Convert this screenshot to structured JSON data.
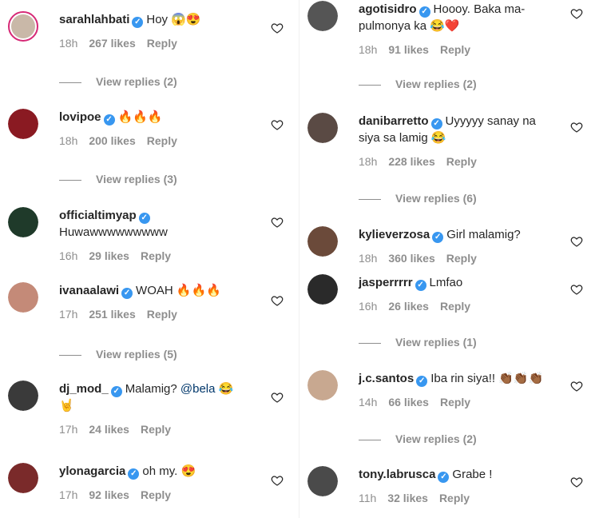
{
  "left": [
    {
      "user": "sarahlahbati",
      "text": "Hoy",
      "emoji": "😱😍",
      "time": "18h",
      "likes": "267 likes",
      "reply": "Reply",
      "view_replies": "View replies (2)",
      "avatar_color": "#c9b8a8",
      "ring": true
    },
    {
      "user": "lovipoe",
      "text": "",
      "emoji": "🔥🔥🔥",
      "time": "18h",
      "likes": "200 likes",
      "reply": "Reply",
      "view_replies": "View replies (3)",
      "avatar_color": "#8a1a22"
    },
    {
      "user": "officialtimyap",
      "text": "Huwawwwwwwwww",
      "emoji": "",
      "time": "16h",
      "likes": "29 likes",
      "reply": "Reply",
      "view_replies": "",
      "avatar_color": "#1f3a2a"
    },
    {
      "user": "ivanaalawi",
      "text": "WOAH",
      "emoji": "🔥🔥🔥",
      "time": "17h",
      "likes": "251 likes",
      "reply": "Reply",
      "view_replies": "View replies (5)",
      "avatar_color": "#c48a78"
    },
    {
      "user": "dj_mod_",
      "text": "Malamig?",
      "mention": "@bela",
      "emoji": "😂",
      "emoji2": "🤘",
      "time": "17h",
      "likes": "24 likes",
      "reply": "Reply",
      "view_replies": "",
      "avatar_color": "#3a3a3a"
    },
    {
      "user": "ylonagarcia",
      "text": "oh my.",
      "emoji": "😍",
      "time": "17h",
      "likes": "92 likes",
      "reply": "Reply",
      "view_replies": "",
      "avatar_color": "#7a2a2a"
    }
  ],
  "right": [
    {
      "user": "agotisidro",
      "text": "Hoooy. Baka ma-",
      "text2": "pulmonya ka",
      "emoji": "😂❤️",
      "time": "18h",
      "likes": "91 likes",
      "reply": "Reply",
      "view_replies": "View replies (2)",
      "avatar_color": "#555555"
    },
    {
      "user": "danibarretto",
      "text": "Uyyyyy sanay na",
      "text2": "siya sa lamig",
      "emoji": "😂",
      "time": "18h",
      "likes": "228 likes",
      "reply": "Reply",
      "view_replies": "View replies (6)",
      "avatar_color": "#5a4a44"
    },
    {
      "user": "kylieverzosa",
      "text": "Girl malamig?",
      "emoji": "",
      "time": "18h",
      "likes": "360 likes",
      "reply": "Reply",
      "view_replies": "",
      "avatar_color": "#6b4a3a"
    },
    {
      "user": "jasperrrrr",
      "text": "Lmfao",
      "emoji": "",
      "time": "16h",
      "likes": "26 likes",
      "reply": "Reply",
      "view_replies": "View replies (1)",
      "avatar_color": "#2a2a2a"
    },
    {
      "user": "j.c.santos",
      "text": "Iba rin siya!!",
      "emoji": "👏🏾👏🏾👏🏾",
      "time": "14h",
      "likes": "66 likes",
      "reply": "Reply",
      "view_replies": "View replies (2)",
      "avatar_color": "#c8a890"
    },
    {
      "user": "tony.labrusca",
      "text": "Grabe !",
      "emoji": "",
      "time": "11h",
      "likes": "32 likes",
      "reply": "Reply",
      "view_replies": "",
      "avatar_color": "#4a4a4a"
    }
  ],
  "icons": {
    "verified": "verified-badge-icon",
    "heart": "heart-outline-icon"
  },
  "colors": {
    "verified": "#3897f0",
    "meta": "#8e8e8e",
    "mention": "#00376b"
  }
}
